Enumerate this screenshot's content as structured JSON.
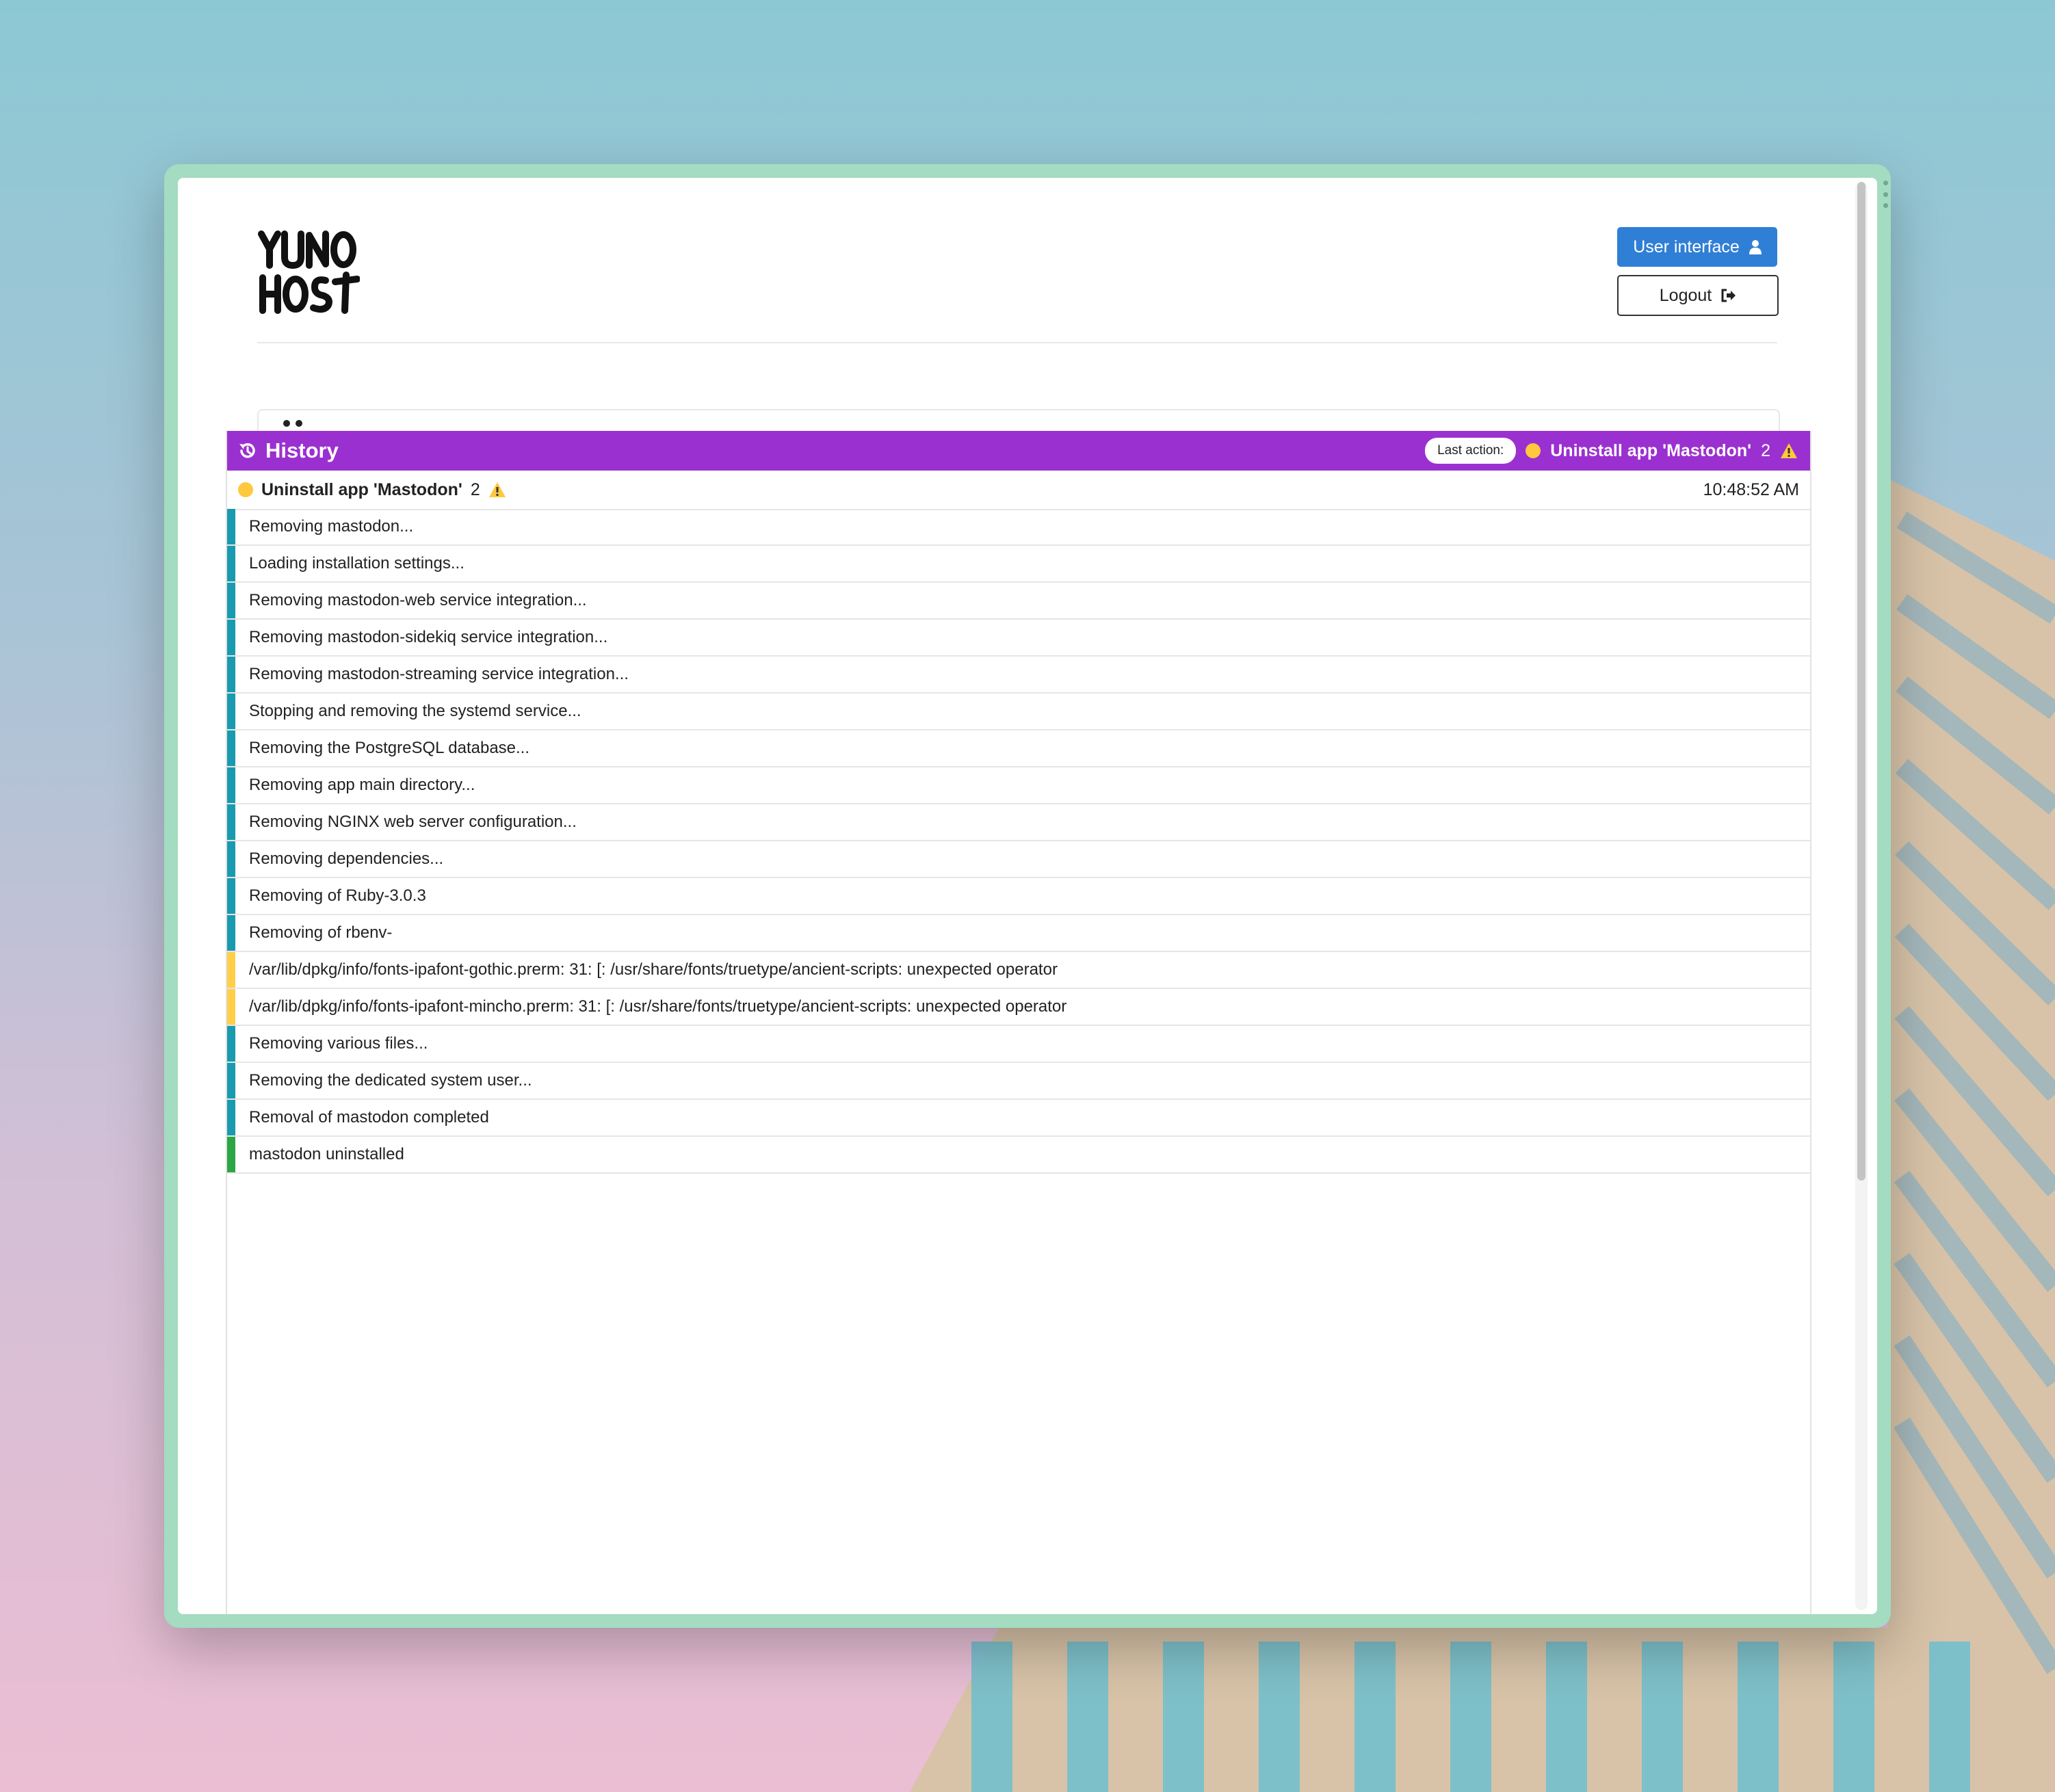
{
  "app": {
    "logo_text": "YUNO HOST"
  },
  "header": {
    "user_interface_label": "User interface",
    "logout_label": "Logout"
  },
  "history": {
    "title": "History",
    "last_action_label": "Last action:",
    "last_action": {
      "title": "Uninstall app 'Mastodon'",
      "warning_count": "2"
    },
    "operation": {
      "title": "Uninstall app 'Mastodon'",
      "warning_count": "2",
      "time": "10:48:52 AM"
    },
    "logs": [
      {
        "level": "info",
        "text": "Removing mastodon..."
      },
      {
        "level": "info",
        "text": "Loading installation settings..."
      },
      {
        "level": "info",
        "text": "Removing mastodon-web service integration..."
      },
      {
        "level": "info",
        "text": "Removing mastodon-sidekiq service integration..."
      },
      {
        "level": "info",
        "text": "Removing mastodon-streaming service integration..."
      },
      {
        "level": "info",
        "text": "Stopping and removing the systemd service..."
      },
      {
        "level": "info",
        "text": "Removing the PostgreSQL database..."
      },
      {
        "level": "info",
        "text": "Removing app main directory..."
      },
      {
        "level": "info",
        "text": "Removing NGINX web server configuration..."
      },
      {
        "level": "info",
        "text": "Removing dependencies..."
      },
      {
        "level": "info",
        "text": "Removing of Ruby-3.0.3"
      },
      {
        "level": "info",
        "text": "Removing of rbenv-"
      },
      {
        "level": "warning",
        "text": "/var/lib/dpkg/info/fonts-ipafont-gothic.prerm: 31: [: /usr/share/fonts/truetype/ancient-scripts: unexpected operator"
      },
      {
        "level": "warning",
        "text": "/var/lib/dpkg/info/fonts-ipafont-mincho.prerm: 31: [: /usr/share/fonts/truetype/ancient-scripts: unexpected operator"
      },
      {
        "level": "info",
        "text": "Removing various files..."
      },
      {
        "level": "info",
        "text": "Removing the dedicated system user..."
      },
      {
        "level": "info",
        "text": "Removal of mastodon completed"
      },
      {
        "level": "success",
        "text": "mastodon uninstalled"
      }
    ]
  },
  "colors": {
    "primary": "#2f7fd6",
    "history_header": "#9b30d0",
    "info": "#1a9aaf",
    "warning": "#ffcf4a",
    "success": "#2aa645"
  }
}
